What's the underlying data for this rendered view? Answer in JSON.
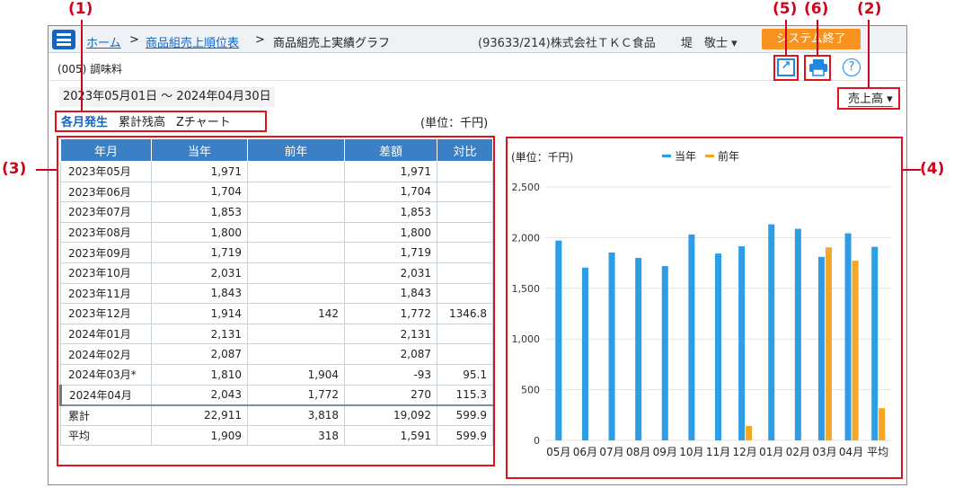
{
  "callouts": {
    "c1": "(1)",
    "c2": "(2)",
    "c3": "(3)",
    "c4": "(4)",
    "c5": "(5)",
    "c6": "(6)"
  },
  "header": {
    "crumb_home": "ホーム",
    "crumb_sep": ">",
    "crumb_ranking": "商品組売上順位表",
    "crumb_current": "商品組売上実績グラフ",
    "company": "(93633/214)株式会社ＴＫＣ食品",
    "user": "堤　敬士 ▾",
    "exit_label": "システム終了"
  },
  "subbar": {
    "category": "(005) 調味料",
    "export_icon": "open-external-icon",
    "print_icon": "printer-icon",
    "help_icon": "help-icon",
    "help_glyph": "?"
  },
  "filters": {
    "date_range": "2023年05月01日 ～ 2024年04月30日",
    "metric": "売上高",
    "metric_arrow": "▾",
    "tabs": [
      "各月発生",
      "累計残高",
      "Zチャート"
    ],
    "unit": "(単位：千円)"
  },
  "table": {
    "headers": [
      "年月",
      "当年",
      "前年",
      "差額",
      "対比"
    ],
    "rows": [
      [
        "2023年05月",
        "1,971",
        "",
        "1,971",
        ""
      ],
      [
        "2023年06月",
        "1,704",
        "",
        "1,704",
        ""
      ],
      [
        "2023年07月",
        "1,853",
        "",
        "1,853",
        ""
      ],
      [
        "2023年08月",
        "1,800",
        "",
        "1,800",
        ""
      ],
      [
        "2023年09月",
        "1,719",
        "",
        "1,719",
        ""
      ],
      [
        "2023年10月",
        "2,031",
        "",
        "2,031",
        ""
      ],
      [
        "2023年11月",
        "1,843",
        "",
        "1,843",
        ""
      ],
      [
        "2023年12月",
        "1,914",
        "142",
        "1,772",
        "1346.8"
      ],
      [
        "2024年01月",
        "2,131",
        "",
        "2,131",
        ""
      ],
      [
        "2024年02月",
        "2,087",
        "",
        "2,087",
        ""
      ],
      [
        "2024年03月*",
        "1,810",
        "1,904",
        "-93",
        "95.1"
      ],
      [
        "2024年04月",
        "2,043",
        "1,772",
        "270",
        "115.3"
      ]
    ],
    "totals": [
      [
        "累計",
        "22,911",
        "3,818",
        "19,092",
        "599.9"
      ],
      [
        "平均",
        "1,909",
        "318",
        "1,591",
        "599.9"
      ]
    ]
  },
  "chart_data": {
    "type": "bar",
    "unit_label": "(単位：千円)",
    "categories": [
      "05月",
      "06月",
      "07月",
      "08月",
      "09月",
      "10月",
      "11月",
      "12月",
      "01月",
      "02月",
      "03月",
      "04月",
      "平均"
    ],
    "series": [
      {
        "name": "当年",
        "color": "#2d9de6",
        "values": [
          1971,
          1704,
          1853,
          1800,
          1719,
          2031,
          1843,
          1914,
          2131,
          2087,
          1810,
          2043,
          1909
        ]
      },
      {
        "name": "前年",
        "color": "#f5a623",
        "values": [
          null,
          null,
          null,
          null,
          null,
          null,
          null,
          142,
          null,
          null,
          1904,
          1772,
          318
        ]
      }
    ],
    "ylim": [
      0,
      2500
    ],
    "yticks": [
      0,
      500,
      1000,
      1500,
      2000,
      2500
    ],
    "ytick_labels": [
      "0",
      "500",
      "1,000",
      "1,500",
      "2,000",
      "2,500"
    ],
    "grid": true,
    "legend": "top"
  }
}
